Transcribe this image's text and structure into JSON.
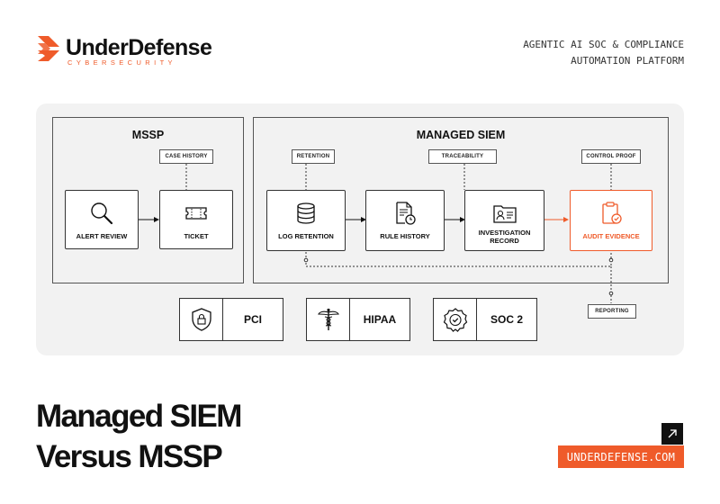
{
  "brand": {
    "name": "UnderDefense",
    "subtitle": "CYBERSECURITY",
    "accent_color": "#ef5b2a"
  },
  "tagline": [
    "AGENTIC AI SOC & COMPLIANCE",
    "AUTOMATION PLATFORM"
  ],
  "diagram": {
    "mssp": {
      "title": "MSSP",
      "tag": "CASE HISTORY",
      "nodes": [
        {
          "label": "ALERT REVIEW",
          "icon": "magnifier-icon"
        },
        {
          "label": "TICKET",
          "icon": "ticket-icon"
        }
      ]
    },
    "siem": {
      "title": "MANAGED SIEM",
      "tags": [
        "RETENTION",
        "TRACEABILITY",
        "CONTROL PROOF"
      ],
      "nodes": [
        {
          "label": "LOG RETENTION",
          "icon": "database-icon"
        },
        {
          "label": "RULE HISTORY",
          "icon": "document-clock-icon"
        },
        {
          "label": "INVESTIGATION RECORD",
          "icon": "folder-id-icon"
        },
        {
          "label": "AUDIT EVIDENCE",
          "icon": "clipboard-check-icon",
          "highlight": true
        }
      ]
    },
    "reporting_tag": "REPORTING",
    "compliance": [
      {
        "label": "PCI",
        "icon": "shield-lock-icon"
      },
      {
        "label": "HIPAA",
        "icon": "caduceus-icon"
      },
      {
        "label": "SOC 2",
        "icon": "badge-check-icon"
      }
    ]
  },
  "headline": [
    "Managed SIEM",
    "Versus MSSP"
  ],
  "website": "UNDERDEFENSE.COM"
}
